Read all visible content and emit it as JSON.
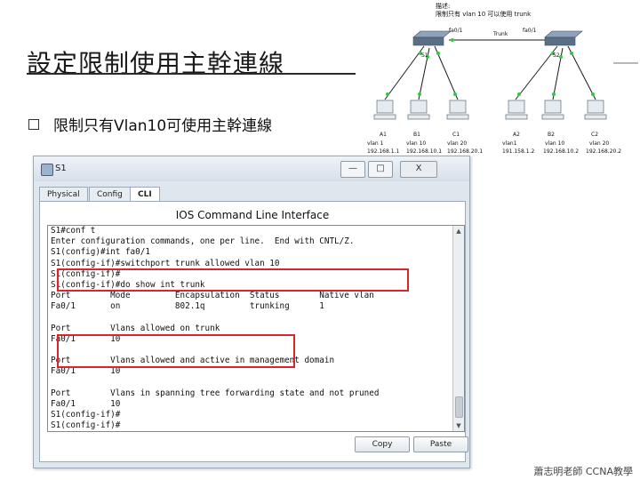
{
  "slide": {
    "title": "設定限制使用主幹連線",
    "bullet": "限制只有Vlan10可使用主幹連線",
    "footer": "蕭志明老師 CCNA教學"
  },
  "topology": {
    "note_heading": "描述:",
    "note_body": "限制只有 vlan 10 可以使用 trunk",
    "trunk_label": "Trunk",
    "left_switch_port": "fa0/1",
    "right_switch_port": "fa0/1",
    "left_switch_name": "S1",
    "right_switch_name": "S2",
    "hosts": [
      {
        "name": "A1",
        "vlan": "vlan 1",
        "ip": "192.168.1.1"
      },
      {
        "name": "B1",
        "vlan": "vlan 10",
        "ip": "192.168.10.1"
      },
      {
        "name": "C1",
        "vlan": "vlan 20",
        "ip": "192.168.20.1"
      },
      {
        "name": "A2",
        "vlan": "vlan1",
        "ip": "191.158.1.2"
      },
      {
        "name": "B2",
        "vlan": "vlan 10",
        "ip": "192.168.10.2"
      },
      {
        "name": "C2",
        "vlan": "vlan 20",
        "ip": "192.168.20.2"
      }
    ],
    "colors": {
      "link": "#1a1a1a",
      "port_dot": "#2ecc40",
      "switch": "#5a6f86"
    }
  },
  "window": {
    "title": "S1",
    "minimize_icon": "—",
    "maximize_icon": "□",
    "close_icon": "X",
    "tabs": [
      "Physical",
      "Config",
      "CLI"
    ],
    "active_tab": "CLI",
    "panel_heading": "IOS Command Line Interface",
    "buttons": {
      "copy": "Copy",
      "paste": "Paste"
    },
    "highlight_color": "#d9252b"
  },
  "cli": {
    "lines": [
      "S1#conf t",
      "Enter configuration commands, one per line.  End with CNTL/Z.",
      "S1(config)#int fa0/1",
      "S1(config-if)#switchport trunk allowed vlan 10",
      "S1(config-if)#",
      "S1(config-if)#do show int trunk",
      "Port        Mode         Encapsulation  Status        Native vlan",
      "Fa0/1       on           802.1q         trunking      1",
      "",
      "Port        Vlans allowed on trunk",
      "Fa0/1       10",
      "",
      "Port        Vlans allowed and active in management domain",
      "Fa0/1       10",
      "",
      "Port        Vlans in spanning tree forwarding state and not pruned",
      "Fa0/1       10",
      "S1(config-if)#",
      "S1(config-if)#"
    ]
  }
}
